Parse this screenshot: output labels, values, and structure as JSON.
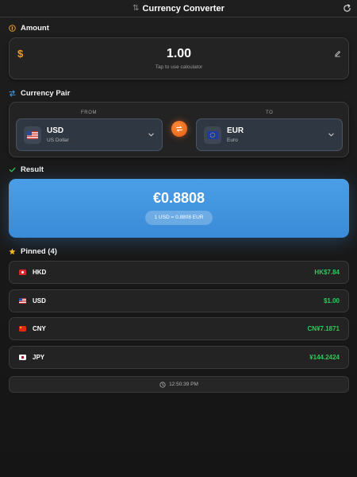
{
  "header": {
    "title": "Currency Converter",
    "app_icon": "⇅"
  },
  "amount": {
    "label": "Amount",
    "symbol": "$",
    "value": "1.00",
    "hint": "Tap to use calculator"
  },
  "pair": {
    "label": "Currency Pair",
    "from_label": "FROM",
    "to_label": "TO",
    "from": {
      "code": "USD",
      "name": "US Dollar"
    },
    "to": {
      "code": "EUR",
      "name": "Euro"
    }
  },
  "result": {
    "label": "Result",
    "value": "€0.8808",
    "rate": "1 USD = 0.8808 EUR"
  },
  "pinned": {
    "label": "Pinned (4)",
    "items": [
      {
        "code": "HKD",
        "amount": "HK$7.84"
      },
      {
        "code": "USD",
        "amount": "$1.00"
      },
      {
        "code": "CNY",
        "amount": "CN¥7.1871"
      },
      {
        "code": "JPY",
        "amount": "¥144.2424"
      }
    ]
  },
  "updated": {
    "time": "12:50:39 PM"
  },
  "colors": {
    "accent_orange": "#f39c1f",
    "result_blue": "#3a8bd8",
    "positive_green": "#34c759",
    "check_green": "#34c759",
    "star_yellow": "#f5b623"
  },
  "icons": {
    "header": "arrows-up-down-icon",
    "refresh": "refresh-icon",
    "amount_section": "circle-dollar-icon",
    "pair_section": "arrows-swap-icon",
    "result_section": "checkmark-icon",
    "pinned_section": "star-icon",
    "edit": "pencil-icon",
    "dropdown": "chevron-down-icon",
    "swap": "swap-icon",
    "clock": "clock-icon"
  }
}
